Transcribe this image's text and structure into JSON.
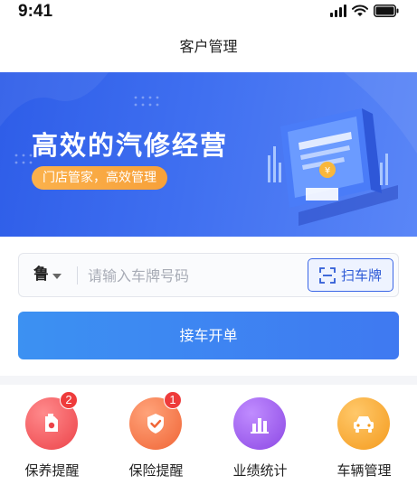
{
  "status_bar": {
    "time": "9:41",
    "icons": [
      "signal-icon",
      "wifi-icon",
      "battery-icon"
    ]
  },
  "nav": {
    "title": "客户管理"
  },
  "banner": {
    "title": "高效的汽修经营",
    "tagline": "门店管家，高效管理",
    "colors": {
      "background": "#3f6ff0",
      "pill": "#f7a13a"
    }
  },
  "plate": {
    "province": "鲁",
    "placeholder": "请输入车牌号码",
    "value": "",
    "scan_label": "扫车牌",
    "scan_icon": "scan-icon"
  },
  "primary_action": {
    "label": "接车开单",
    "color": "#3f85f2"
  },
  "quick_entries": [
    {
      "label": "保养提醒",
      "icon": "oil-can-icon",
      "badge": "2",
      "color": "#f0565a"
    },
    {
      "label": "保险提醒",
      "icon": "shield-check-icon",
      "badge": "1",
      "color": "#f4713e"
    },
    {
      "label": "业绩统计",
      "icon": "bar-chart-icon",
      "badge": "",
      "color": "#9a56e8"
    },
    {
      "label": "车辆管理",
      "icon": "car-icon",
      "badge": "",
      "color": "#f7a62e"
    }
  ]
}
